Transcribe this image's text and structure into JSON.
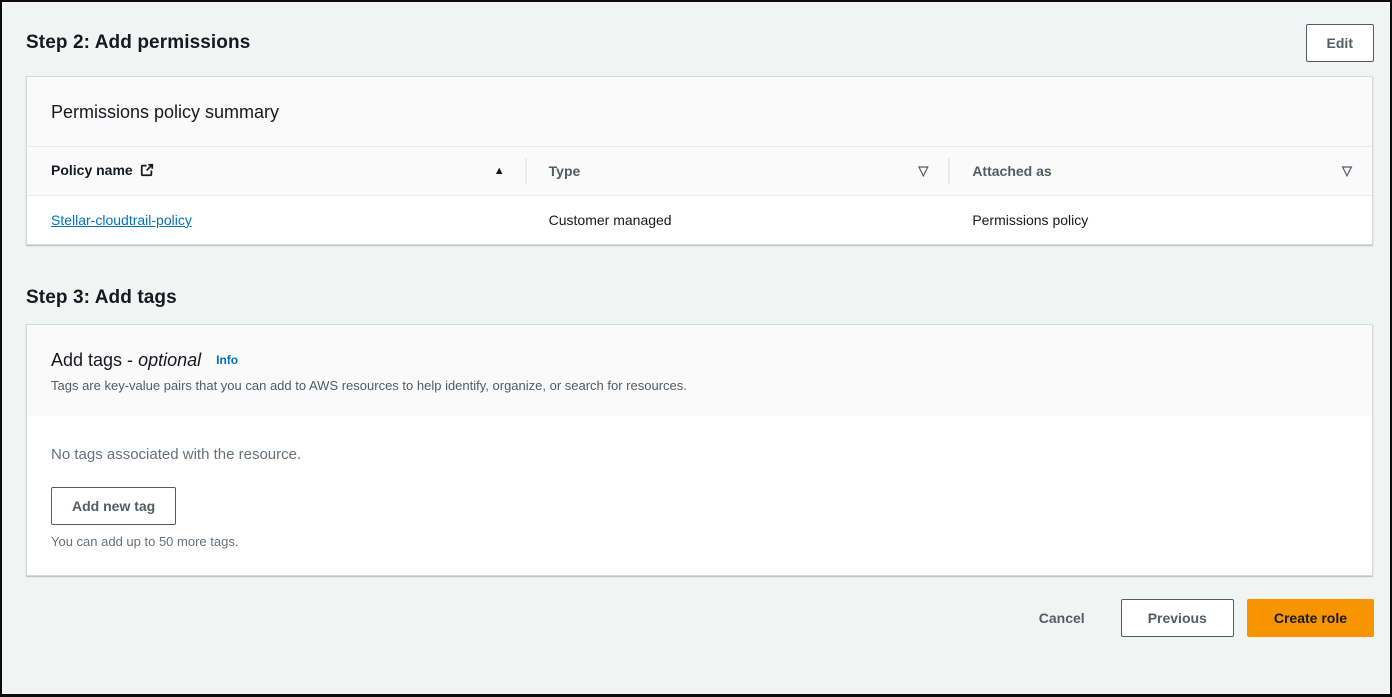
{
  "colors": {
    "accent_orange": "#f79400",
    "link_blue": "#0073bb",
    "button_gray": "#545b64",
    "page_background": "#f2f3f3"
  },
  "icons": {
    "external_link": "external-link",
    "sort_ascending": "▲",
    "filter": "▽"
  },
  "step2": {
    "heading": "Step 2: Add permissions",
    "edit_button": "Edit"
  },
  "permissions_panel": {
    "title": "Permissions policy summary",
    "table": {
      "columns": [
        {
          "label": "Policy name",
          "sort_icon": "▲"
        },
        {
          "label": "Type",
          "filter_icon": "▽"
        },
        {
          "label": "Attached as",
          "filter_icon": "▽"
        }
      ],
      "rows": [
        {
          "policy_name": "Stellar-cloudtrail-policy",
          "type": "Customer managed",
          "attached_as": "Permissions policy"
        }
      ]
    }
  },
  "step3": {
    "heading": "Step 3: Add tags"
  },
  "tags_panel": {
    "title": "Add tags -",
    "optional_label": "optional",
    "info_link": "Info",
    "description": "Tags are key-value pairs that you can add to AWS resources to help identify, organize, or search for resources.",
    "empty_message": "No tags associated with the resource.",
    "add_tag_button": "Add new tag",
    "hint": "You can add up to 50 more tags."
  },
  "footer": {
    "cancel": "Cancel",
    "previous": "Previous",
    "create_role": "Create role"
  }
}
